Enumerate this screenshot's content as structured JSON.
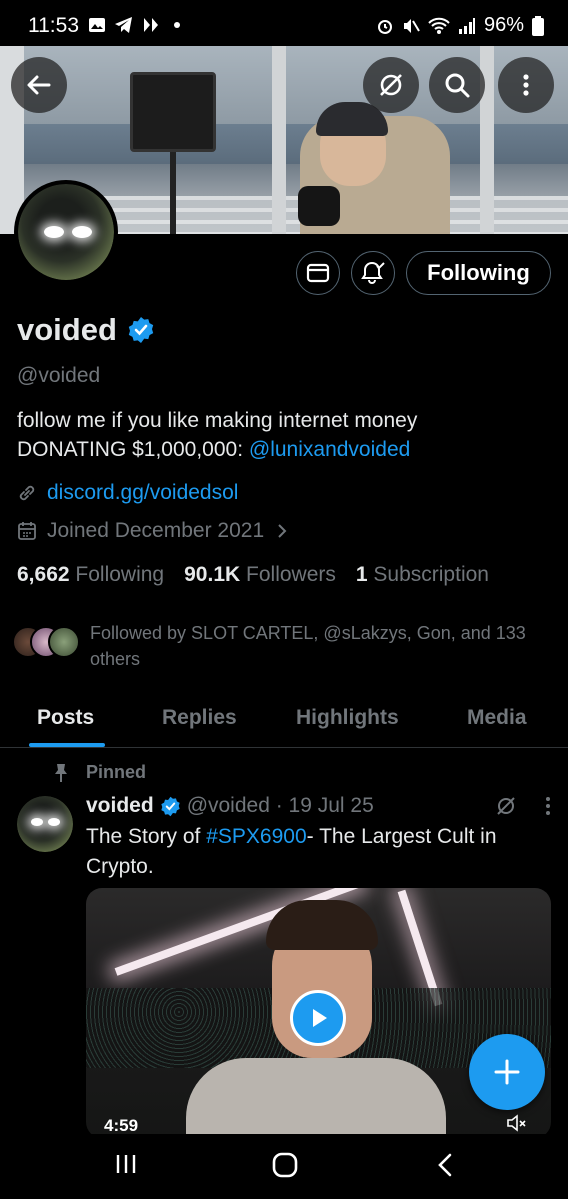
{
  "status_bar": {
    "time": "11:53",
    "battery": "96%"
  },
  "profile": {
    "display_name": "voided",
    "handle": "@voided",
    "bio_line1": "follow me if you like making internet money",
    "bio_line2_prefix": "DONATING $1,000,000: ",
    "bio_line2_mention": "@lunixandvoided",
    "website": "discord.gg/voidedsol",
    "joined": "Joined December 2021",
    "following_count": "6,662",
    "following_label": "Following",
    "followers_count": "90.1K",
    "followers_label": "Followers",
    "subscription_count": "1",
    "subscription_label": "Subscription",
    "followed_by": "Followed by SLOT CARTEL, @sLakzys, Gon, and 133 others",
    "follow_button": "Following"
  },
  "tabs": [
    {
      "label": "Posts",
      "active": true
    },
    {
      "label": "Replies",
      "active": false
    },
    {
      "label": "Highlights",
      "active": false
    },
    {
      "label": "Media",
      "active": false
    }
  ],
  "post": {
    "pinned_label": "Pinned",
    "author": "voided",
    "handle_date": "@voided · 19 Jul 25",
    "text_prefix": "The Story of ",
    "hashtag": "#SPX6900",
    "text_suffix": "- The Largest Cult in Crypto.",
    "video_duration": "4:59"
  },
  "colors": {
    "accent": "#1d9bf0",
    "background": "#000000",
    "muted_text": "#71767b",
    "primary_text": "#e7e9ea"
  },
  "icons": [
    "back-arrow-icon",
    "grok-icon",
    "search-icon",
    "more-vertical-icon",
    "mail-icon",
    "bell-check-icon",
    "link-icon",
    "calendar-icon",
    "chevron-right-icon",
    "pin-icon",
    "verified-badge-icon",
    "play-icon",
    "mute-icon",
    "plus-icon",
    "recents-icon",
    "home-icon",
    "back-icon"
  ]
}
